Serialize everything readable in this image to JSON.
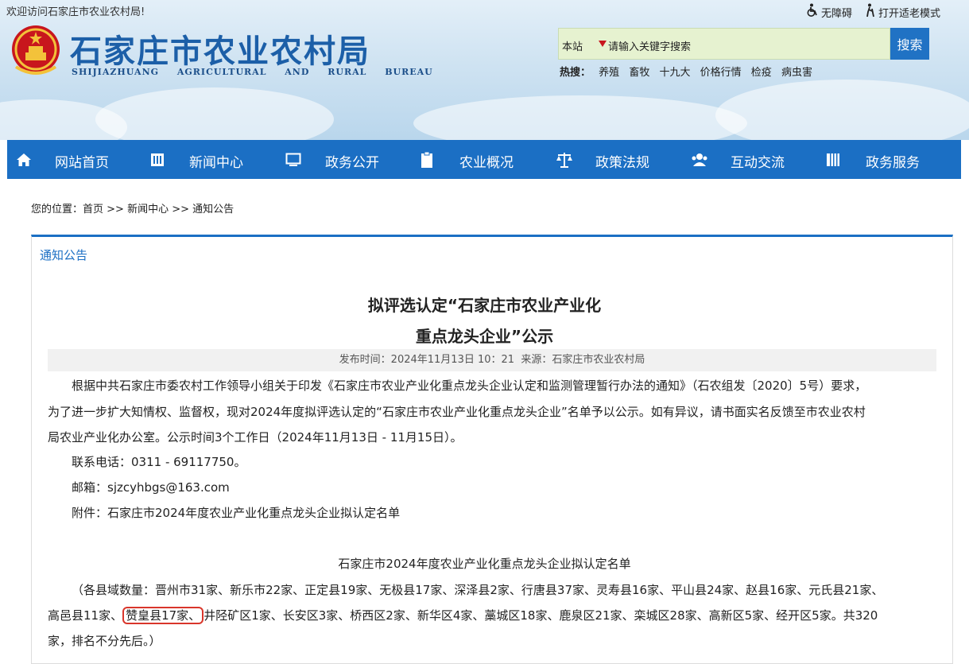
{
  "header": {
    "welcome": "欢迎访问石家庄市农业农村局!",
    "accessible": "无障碍",
    "elder_mode": "打开适老模式",
    "logo_cn": "石家庄市农业农村局",
    "logo_en": "SHIJIAZHUANG AGRICULTURAL AND RURAL BUREAU"
  },
  "search": {
    "scope": "本站",
    "placeholder": "请输入关键字搜索",
    "button": "搜索"
  },
  "hot": {
    "label": "热搜：",
    "keywords": [
      "养殖",
      "畜牧",
      "十九大",
      "价格行情",
      "检疫",
      "病虫害"
    ]
  },
  "nav": {
    "items": [
      {
        "label": "网站首页",
        "icon": "home-icon"
      },
      {
        "label": "新闻中心",
        "icon": "news-icon"
      },
      {
        "label": "政务公开",
        "icon": "monitor-icon"
      },
      {
        "label": "农业概况",
        "icon": "clipboard-icon"
      },
      {
        "label": "政策法规",
        "icon": "scales-icon"
      },
      {
        "label": "互动交流",
        "icon": "users-icon"
      },
      {
        "label": "政务服务",
        "icon": "grid-icon"
      }
    ]
  },
  "breadcrumb": {
    "prefix": "您的位置：",
    "home": "首页",
    "sep": " >> ",
    "level1": "新闻中心",
    "level2": "通知公告"
  },
  "panel": {
    "title": "通知公告"
  },
  "article": {
    "title_line1": "拟评选认定“石家庄市农业产业化",
    "title_line2": "重点龙头企业”公示",
    "meta": "发布时间：2024年11月13日 10：21  来源：石家庄市农业农村局",
    "para1_l1": "根据中共石家庄市委农村工作领导小组关于印发《石家庄市农业产业化重点龙头企业认定和监测管理暂行办法的通知》（石农组发〔2020〕5号）要求，",
    "para1_l2": "为了进一步扩大知情权、监督权，现对2024年度拟评选认定的“石家庄市农业产业化重点龙头企业”名单予以公示。如有异议，请书面实名反馈至市农业农村",
    "para1_l3": "局农业产业化办公室。公示时间3个工作日（2024年11月13日 - 11月15日）。",
    "phone": "联系电话：0311 - 69117750。",
    "email": "邮箱：sjzcyhbgs@163.com",
    "attachment": "附件：石家庄市2024年度农业产业化重点龙头企业拟认定名单",
    "list_title": "石家庄市2024年度农业产业化重点龙头企业拟认定名单",
    "counts_l1": "（各县域数量：晋州市31家、新乐市22家、正定县19家、无极县17家、深泽县2家、行唐县37家、灵寿县16家、平山县24家、赵县16家、元氏县21家、",
    "counts_l2_a": "高邑县11家、",
    "counts_l2_hl": "赞皇县17家、",
    "counts_l2_b": "井陉矿区1家、长安区3家、桥西区2家、新华区4家、藁城区18家、鹿泉区21家、栾城区28家、高新区5家、经开区5家。共320",
    "counts_l3": "家，排名不分先后。）"
  }
}
